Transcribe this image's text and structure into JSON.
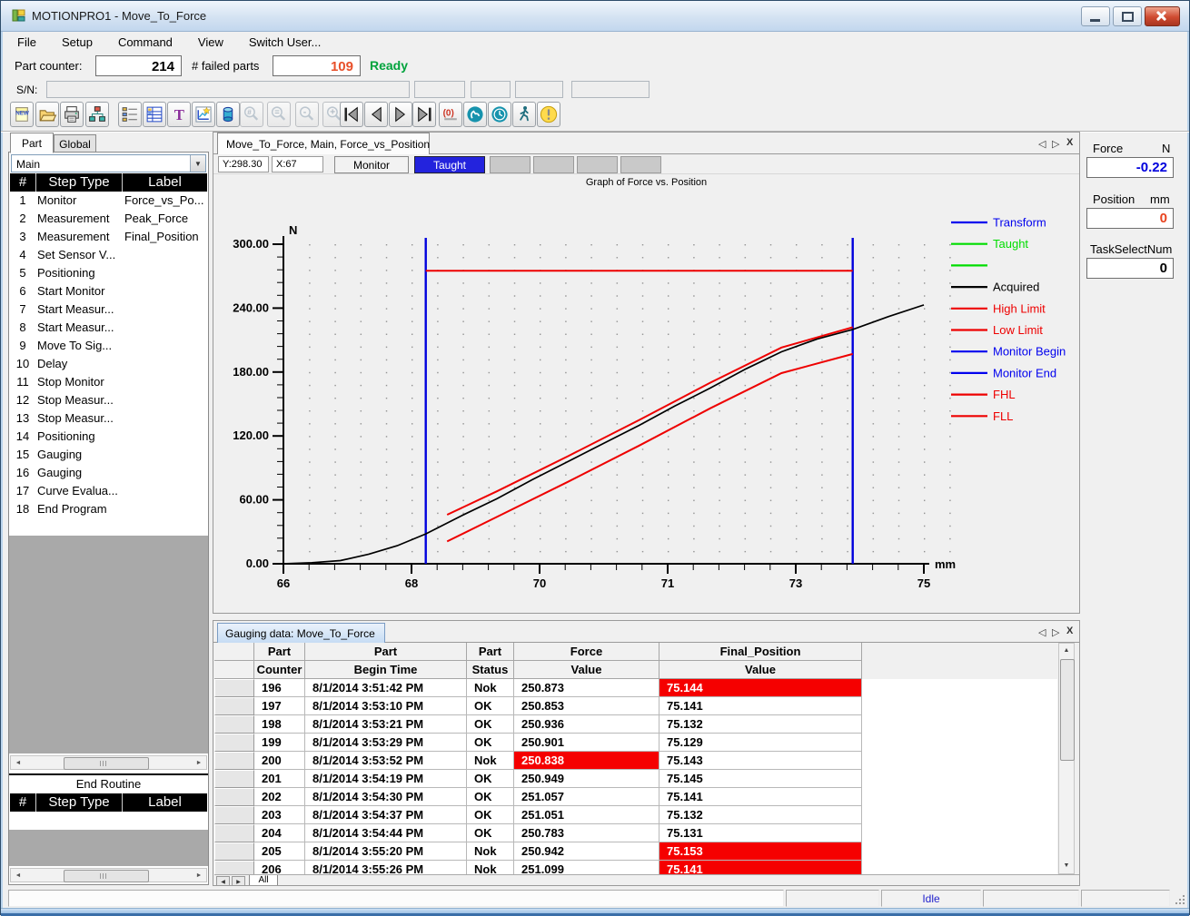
{
  "window": {
    "title": "MOTIONPRO1 - Move_To_Force"
  },
  "menu": {
    "items": [
      "File",
      "Setup",
      "Command",
      "View",
      "Switch User..."
    ]
  },
  "header": {
    "part_counter_label": "Part counter:",
    "part_counter_value": "214",
    "failed_parts_label": "# failed parts",
    "failed_parts_value": "109",
    "ready_status": "Ready",
    "serial_label": "S/N:",
    "failed_color": "#e8502a",
    "ready_color": "#00a33c"
  },
  "toolbar": {
    "groups": [
      [
        "new-file",
        "open-folder",
        "print",
        "flowchart"
      ],
      [
        "step-list",
        "program-grid",
        "text-tool",
        "chart-export",
        "cylinder-tool"
      ],
      [
        "zoom-number",
        "zoom-equal",
        "zoom-out",
        "zoom-in"
      ],
      [
        "nav-first",
        "nav-prev",
        "nav-next",
        "nav-last"
      ],
      [
        "counter-reset",
        "dial",
        "timer",
        "person-walking",
        "alarm"
      ]
    ]
  },
  "left_panel": {
    "tabs": [
      "Part",
      "Global"
    ],
    "active_tab": "Part",
    "routine_dropdown": "Main",
    "step_columns": [
      "#",
      "Step Type",
      "Label"
    ],
    "steps": [
      {
        "num": "1",
        "type": "Monitor",
        "label": "Force_vs_Po..."
      },
      {
        "num": "2",
        "type": "Measurement",
        "label": "Peak_Force"
      },
      {
        "num": "3",
        "type": "Measurement",
        "label": "Final_Position"
      },
      {
        "num": "4",
        "type": "Set Sensor V...",
        "label": ""
      },
      {
        "num": "5",
        "type": "Positioning",
        "label": ""
      },
      {
        "num": "6",
        "type": "Start Monitor",
        "label": ""
      },
      {
        "num": "7",
        "type": "Start Measur...",
        "label": ""
      },
      {
        "num": "8",
        "type": "Start Measur...",
        "label": ""
      },
      {
        "num": "9",
        "type": "Move To Sig...",
        "label": ""
      },
      {
        "num": "10",
        "type": "Delay",
        "label": ""
      },
      {
        "num": "11",
        "type": "Stop Monitor",
        "label": ""
      },
      {
        "num": "12",
        "type": "Stop Measur...",
        "label": ""
      },
      {
        "num": "13",
        "type": "Stop Measur...",
        "label": ""
      },
      {
        "num": "14",
        "type": "Positioning",
        "label": ""
      },
      {
        "num": "15",
        "type": "Gauging",
        "label": ""
      },
      {
        "num": "16",
        "type": "Gauging",
        "label": ""
      },
      {
        "num": "17",
        "type": "Curve Evalua...",
        "label": ""
      },
      {
        "num": "18",
        "type": "End Program",
        "label": ""
      }
    ],
    "end_routine": {
      "title": "End Routine",
      "columns": [
        "#",
        "Step Type",
        "Label"
      ]
    }
  },
  "chart_panel": {
    "tab_title": "Move_To_Force, Main,  Force_vs_Position",
    "y_readout": "Y:298.30",
    "x_readout": "X:67",
    "monitor_button": "Monitor",
    "taught_button": "Taught",
    "taught_color": "#2323dd",
    "graph_title": "Graph of Force vs. Position"
  },
  "chart_data": {
    "type": "line",
    "title": "Graph of Force vs. Position",
    "xlabel": "mm",
    "ylabel": "N",
    "x_range": [
      66,
      75
    ],
    "y_range": [
      0,
      300
    ],
    "x_tick_labels": [
      "66",
      "68",
      "70",
      "71",
      "73",
      "75"
    ],
    "y_tick_labels": [
      "0.00",
      "60.00",
      "120.00",
      "180.00",
      "240.00",
      "300.00"
    ],
    "grid": "dotted",
    "legend_position": "right",
    "legend": [
      {
        "label": "Transform",
        "color": "#0000ee"
      },
      {
        "label": "Taught",
        "color": "#00dd00"
      },
      {
        "label": "",
        "color": "#00dd00"
      },
      {
        "label": "Acquired",
        "color": "#000000"
      },
      {
        "label": "High Limit",
        "color": "#ee0000"
      },
      {
        "label": "Low Limit",
        "color": "#ee0000"
      },
      {
        "label": "Monitor Begin",
        "color": "#0000ee"
      },
      {
        "label": "Monitor End",
        "color": "#0000ee"
      },
      {
        "label": "FHL",
        "color": "#ee0000"
      },
      {
        "label": "FLL",
        "color": "#ee0000"
      }
    ],
    "series": [
      {
        "name": "Acquired",
        "color": "#000000",
        "width": 1.7,
        "x": [
          66,
          66.4,
          66.8,
          67.2,
          67.6,
          68,
          68.5,
          69,
          69.5,
          70,
          70.5,
          71,
          71.5,
          72,
          72.5,
          73,
          73.5,
          74,
          74.5,
          75
        ],
        "y": [
          0,
          1,
          3,
          9,
          17,
          28,
          45,
          61,
          79,
          96,
          113,
          130,
          148,
          165,
          183,
          199,
          211,
          220,
          232,
          243
        ]
      },
      {
        "name": "High Limit",
        "color": "#ee0000",
        "width": 2,
        "x": [
          68.3,
          69,
          70,
          71,
          72,
          73,
          74
        ],
        "y": [
          46,
          68,
          101,
          135,
          170,
          203,
          222
        ]
      },
      {
        "name": "Low Limit",
        "color": "#ee0000",
        "width": 2,
        "x": [
          68.3,
          69,
          70,
          71,
          72,
          73,
          74
        ],
        "y": [
          21,
          44,
          77,
          111,
          146,
          179,
          197
        ]
      },
      {
        "name": "FHL",
        "color": "#ee0000",
        "width": 2,
        "x": [
          68,
          74
        ],
        "y": [
          275,
          275
        ]
      }
    ],
    "vlines": [
      {
        "name": "Monitor Begin",
        "x": 68,
        "color": "#0000dd"
      },
      {
        "name": "Monitor End",
        "x": 74,
        "color": "#0000dd"
      }
    ]
  },
  "right_panel": {
    "force_label": "Force",
    "force_unit": "N",
    "force_value": "-0.22",
    "force_color": "#0000dd",
    "position_label": "Position",
    "position_unit": "mm",
    "position_value": "0",
    "position_color": "#e8431f",
    "task_select_label": "TaskSelectNum",
    "task_select_value": "0",
    "task_color": "#000000"
  },
  "gauging": {
    "tab_title": "Gauging data:  Move_To_Force",
    "column_groups": [
      "Part",
      "Part",
      "Part",
      "Force",
      "Final_Position"
    ],
    "column_subs": [
      "Counter",
      "Begin Time",
      "Status",
      "Value",
      "Value"
    ],
    "rows": [
      {
        "counter": "196",
        "begin_time": "8/1/2014 3:51:42 PM",
        "status": "Nok",
        "force": "250.873",
        "final": "75.144",
        "force_red": false,
        "final_red": true
      },
      {
        "counter": "197",
        "begin_time": "8/1/2014 3:53:10 PM",
        "status": "OK",
        "force": "250.853",
        "final": "75.141",
        "force_red": false,
        "final_red": false
      },
      {
        "counter": "198",
        "begin_time": "8/1/2014 3:53:21 PM",
        "status": "OK",
        "force": "250.936",
        "final": "75.132",
        "force_red": false,
        "final_red": false
      },
      {
        "counter": "199",
        "begin_time": "8/1/2014 3:53:29 PM",
        "status": "OK",
        "force": "250.901",
        "final": "75.129",
        "force_red": false,
        "final_red": false
      },
      {
        "counter": "200",
        "begin_time": "8/1/2014 3:53:52 PM",
        "status": "Nok",
        "force": "250.838",
        "final": "75.143",
        "force_red": true,
        "final_red": false
      },
      {
        "counter": "201",
        "begin_time": "8/1/2014 3:54:19 PM",
        "status": "OK",
        "force": "250.949",
        "final": "75.145",
        "force_red": false,
        "final_red": false
      },
      {
        "counter": "202",
        "begin_time": "8/1/2014 3:54:30 PM",
        "status": "OK",
        "force": "251.057",
        "final": "75.141",
        "force_red": false,
        "final_red": false
      },
      {
        "counter": "203",
        "begin_time": "8/1/2014 3:54:37 PM",
        "status": "OK",
        "force": "251.051",
        "final": "75.132",
        "force_red": false,
        "final_red": false
      },
      {
        "counter": "204",
        "begin_time": "8/1/2014 3:54:44 PM",
        "status": "OK",
        "force": "250.783",
        "final": "75.131",
        "force_red": false,
        "final_red": false
      },
      {
        "counter": "205",
        "begin_time": "8/1/2014 3:55:20 PM",
        "status": "Nok",
        "force": "250.942",
        "final": "75.153",
        "force_red": false,
        "final_red": true
      },
      {
        "counter": "206",
        "begin_time": "8/1/2014 3:55:26 PM",
        "status": "Nok",
        "force": "251.099",
        "final": "75.141",
        "force_red": false,
        "final_red": true
      }
    ],
    "sheet_tab": "All"
  },
  "status_bar": {
    "state": "Idle"
  }
}
